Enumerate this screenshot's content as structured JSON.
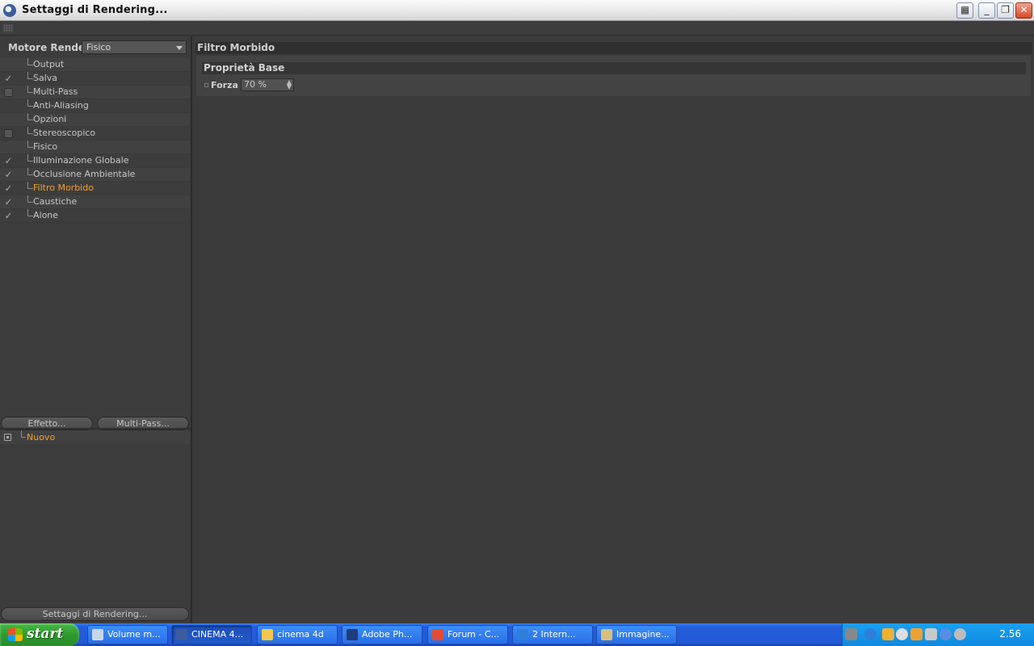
{
  "window": {
    "title": "Settaggi di Rendering...",
    "controls": {
      "grid": "▦",
      "minimize": "_",
      "restore": "❐",
      "close": "✕"
    }
  },
  "left": {
    "engine_label": "Motore Render",
    "engine_value": "Fisico",
    "tree": [
      {
        "label": "Output",
        "check": "none"
      },
      {
        "label": "Salva",
        "check": "checked"
      },
      {
        "label": "Multi-Pass",
        "check": "box"
      },
      {
        "label": "Anti-Aliasing",
        "check": "none"
      },
      {
        "label": "Opzioni",
        "check": "none"
      },
      {
        "label": "Stereoscopico",
        "check": "box"
      },
      {
        "label": "Fisico",
        "check": "none"
      },
      {
        "label": "Illuminazione Globale",
        "check": "checked"
      },
      {
        "label": "Occlusione Ambientale",
        "check": "checked"
      },
      {
        "label": "Filtro Morbido",
        "check": "checked",
        "selected": true
      },
      {
        "label": "Caustiche",
        "check": "checked"
      },
      {
        "label": "Alone",
        "check": "checked"
      }
    ],
    "effect_button": "Effetto...",
    "multipass_button": "Multi-Pass...",
    "new_item": "Nuovo",
    "bottom_button": "Settaggi di Rendering..."
  },
  "right": {
    "header": "Filtro Morbido",
    "group": "Proprietà Base",
    "forza_label": "Forza",
    "forza_value": "70 %"
  },
  "taskbar": {
    "start": "start",
    "tasks": [
      {
        "label": "Volume m...",
        "icon": "document-icon",
        "active": false
      },
      {
        "label": "CINEMA 4...",
        "icon": "cinema4d-icon",
        "active": true
      },
      {
        "label": "cinema 4d",
        "icon": "folder-icon",
        "active": false
      },
      {
        "label": "Adobe Ph...",
        "icon": "photoshop-icon",
        "active": false
      },
      {
        "label": "Forum - C...",
        "icon": "chrome-icon",
        "active": false
      },
      {
        "label": "2 Intern...",
        "icon": "ie-icon",
        "active": false
      },
      {
        "label": "Immagine...",
        "icon": "paint-icon",
        "active": false
      }
    ],
    "clock": "2.56",
    "chevron": "»"
  },
  "colors": {
    "selected_text": "#f2a22a",
    "panel_bg": "#3b3b3b",
    "taskbar": "#245edb"
  }
}
